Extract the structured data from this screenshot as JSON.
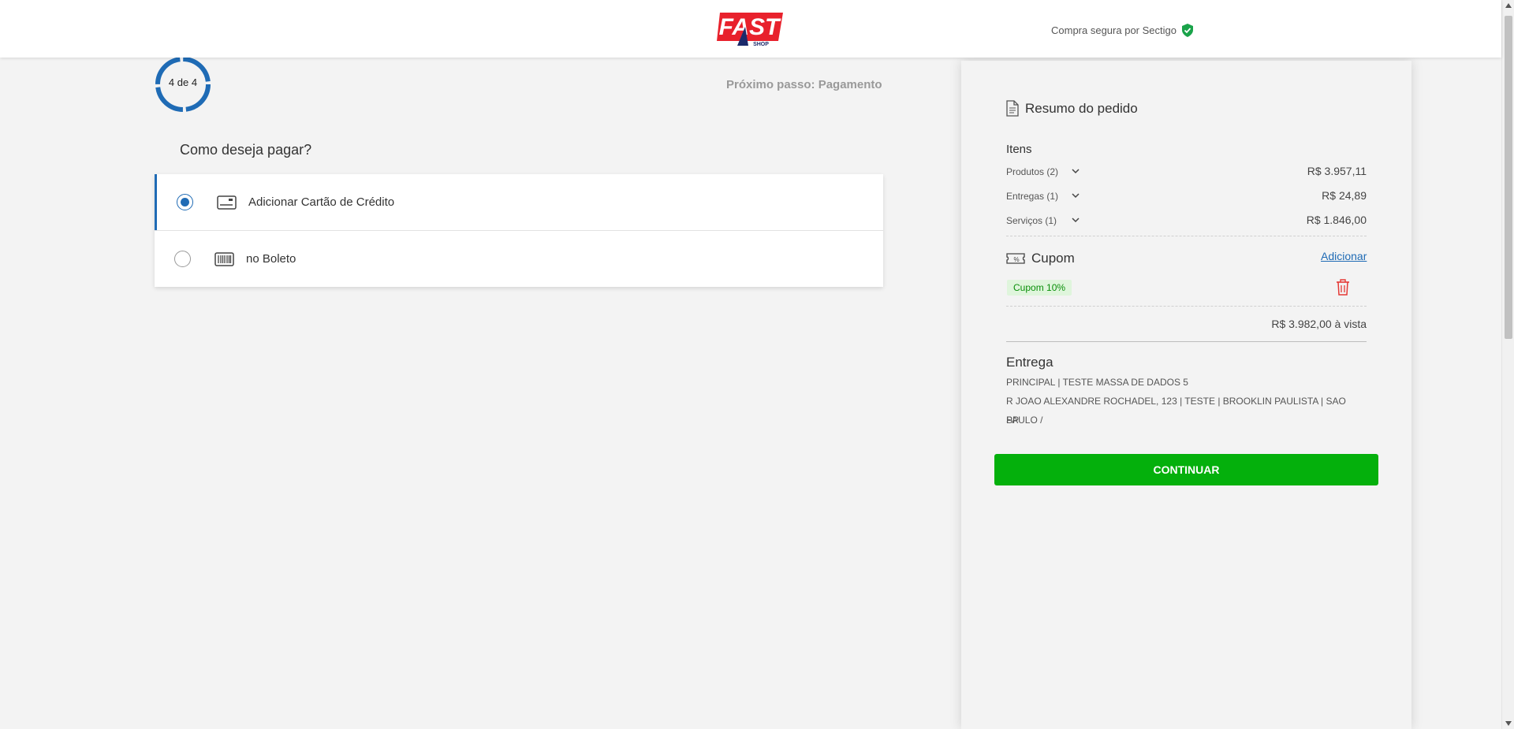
{
  "header": {
    "logo_text": "FAST",
    "logo_subtext": "SHOP",
    "secure_text": "Compra segura por Sectigo",
    "colors": {
      "logo_red": "#e8212c",
      "logo_blue": "#1b2a6b",
      "shield_green": "#1aa34a"
    }
  },
  "progress": {
    "label": "4 de 4",
    "next_step": "Próximo passo: Pagamento",
    "accent": "#1f6bb5"
  },
  "payment": {
    "question": "Como deseja pagar?",
    "options": [
      {
        "label": "Adicionar Cartão de Crédito",
        "icon": "credit-card-icon",
        "selected": true
      },
      {
        "label": "no Boleto",
        "icon": "barcode-icon",
        "selected": false
      }
    ]
  },
  "summary": {
    "title": "Resumo do pedido",
    "items_heading": "Itens",
    "rows": [
      {
        "label": "Produtos (2)",
        "value": "R$ 3.957,11"
      },
      {
        "label": "Entregas (1)",
        "value": "R$ 24,89"
      },
      {
        "label": "Serviços (1)",
        "value": "R$ 1.846,00"
      }
    ],
    "coupon": {
      "title": "Cupom",
      "add_label": "Adicionar",
      "badge": "Cupom 10%"
    },
    "total": "R$ 3.982,00 à vista",
    "delivery": {
      "title": "Entrega",
      "line1": "PRINCIPAL | TESTE MASSA DE DADOS 5",
      "line2": "R JOAO ALEXANDRE ROCHADEL, 123 | TESTE | BROOKLIN PAULISTA | SAO PAULO /",
      "line3": "SP"
    },
    "continue_label": "CONTINUAR",
    "continue_color": "#04b00c"
  }
}
